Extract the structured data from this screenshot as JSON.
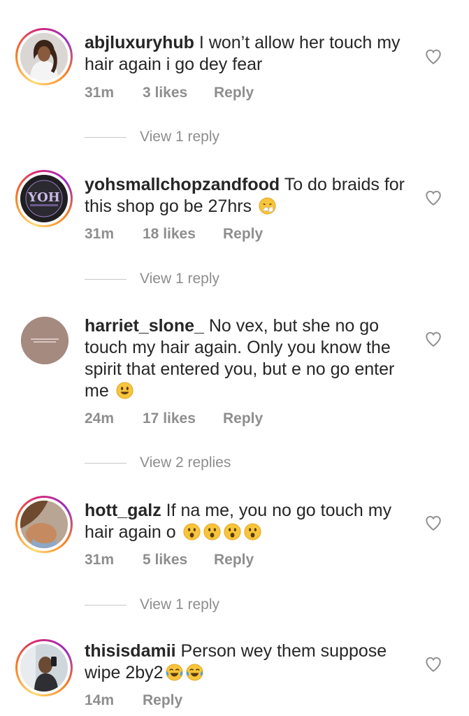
{
  "comments": [
    {
      "username": "abjluxuryhub",
      "text": "I won’t allow her touch my hair again i go dey fear",
      "time": "31m",
      "likes": "3 likes",
      "reply": "Reply",
      "view_replies": "View 1 reply",
      "emojis": []
    },
    {
      "username": "yohsmallchopzandfood",
      "text": "To do braids for this shop go be 27hrs",
      "time": "31m",
      "likes": "18 likes",
      "reply": "Reply",
      "view_replies": "View 1 reply",
      "emojis": [
        "sneezing-face"
      ]
    },
    {
      "username": "harriet_slone_",
      "text": "No vex, but she no go touch my hair again. Only you know the spirit that entered you, but e no go enter me",
      "time": "24m",
      "likes": "17 likes",
      "reply": "Reply",
      "view_replies": "View 2 replies",
      "emojis": [
        "smiley-face"
      ]
    },
    {
      "username": "hott_galz",
      "text": "If na me, you no go touch my hair again o",
      "time": "31m",
      "likes": "5 likes",
      "reply": "Reply",
      "view_replies": "View 1 reply",
      "emojis": [
        "astonished-face",
        "astonished-face",
        "astonished-face",
        "astonished-face"
      ]
    },
    {
      "username": "thisisdamii",
      "text": "Person wey them suppose wipe 2by2",
      "time": "14m",
      "likes": "",
      "reply": "Reply",
      "view_replies": "",
      "emojis": [
        "laughing-tears-face",
        "laughing-tears-face"
      ]
    }
  ],
  "icons": {
    "like": "heart-outline-icon"
  },
  "colors": {
    "text": "#262626",
    "meta": "#8e8e8e",
    "ring_start": "#feda75",
    "ring_end": "#d62976"
  }
}
